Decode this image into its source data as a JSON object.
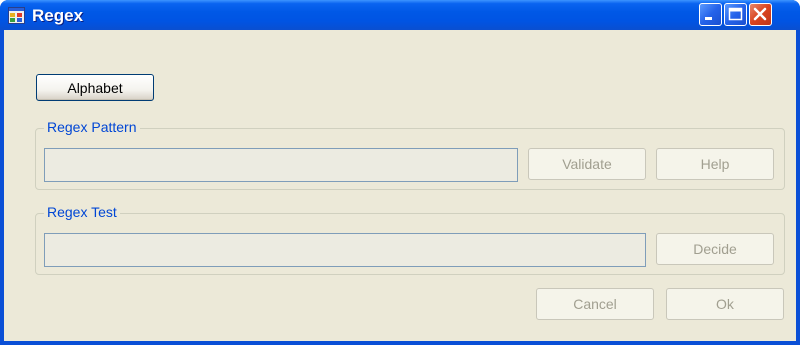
{
  "window": {
    "title": "Regex",
    "icon": "form-window-icon"
  },
  "toolbar": {
    "alphabet_label": "Alphabet"
  },
  "pattern_group": {
    "label": "Regex Pattern",
    "input_value": "",
    "validate_label": "Validate",
    "help_label": "Help"
  },
  "test_group": {
    "label": "Regex Test",
    "input_value": "",
    "decide_label": "Decide"
  },
  "footer": {
    "cancel_label": "Cancel",
    "ok_label": "Ok"
  },
  "colors": {
    "titlebar": "#0054e3",
    "client_bg": "#ece9d8",
    "group_label": "#0046d5",
    "disabled_text": "#a19f90"
  }
}
